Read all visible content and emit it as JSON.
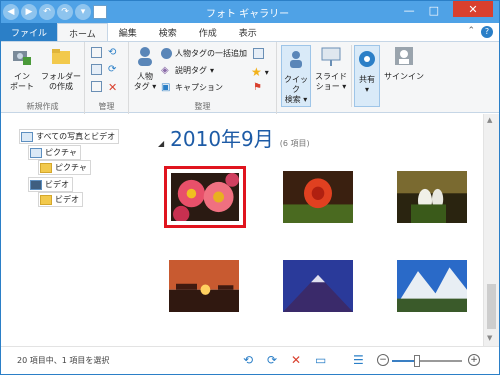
{
  "window": {
    "title": "フォト ギャラリー"
  },
  "tabs": [
    {
      "label": "ファイル"
    },
    {
      "label": "ホーム"
    },
    {
      "label": "編集"
    },
    {
      "label": "検索"
    },
    {
      "label": "作成"
    },
    {
      "label": "表示"
    }
  ],
  "ribbon": {
    "new_group": {
      "import_label_1": "イン",
      "import_label_2": "ポート",
      "new_folder_label_1": "フォルダー",
      "new_folder_label_2": "の作成",
      "group_label": "新規作成"
    },
    "manage_group": {
      "group_label": "管理"
    },
    "organize_group": {
      "people_tag_label_1": "人物",
      "people_tag_label_2": "タグ",
      "batch_people_tag": "人物タグの一括追加",
      "descriptive_tag": "説明タグ",
      "caption": "キャプション",
      "group_label": "整理"
    },
    "quick_search": {
      "label_1": "クイック",
      "label_2": "検索"
    },
    "slideshow": {
      "label_1": "スライド",
      "label_2": "ショー"
    },
    "share": {
      "label": "共有"
    },
    "signin": {
      "label": "サインイン"
    }
  },
  "nav": {
    "items": [
      {
        "label": "すべての写真とビデオ"
      },
      {
        "label": "ピクチャ"
      },
      {
        "label": "ピクチャ"
      },
      {
        "label": "ビデオ"
      },
      {
        "label": "ビデオ"
      }
    ]
  },
  "main": {
    "heading": "2010年9月",
    "count": "(6 項目)",
    "photos": [
      {
        "name": "flowers",
        "selected": true
      },
      {
        "name": "rose"
      },
      {
        "name": "lilies"
      },
      {
        "name": "sunset"
      },
      {
        "name": "mountain"
      },
      {
        "name": "alps"
      }
    ]
  },
  "status": {
    "text": "20 項目中、1 項目を選択"
  },
  "zoom_level": 0.35,
  "colors": {
    "accent": "#2b7fc7",
    "selection": "#e0141e",
    "heading": "#1d5ba6"
  }
}
